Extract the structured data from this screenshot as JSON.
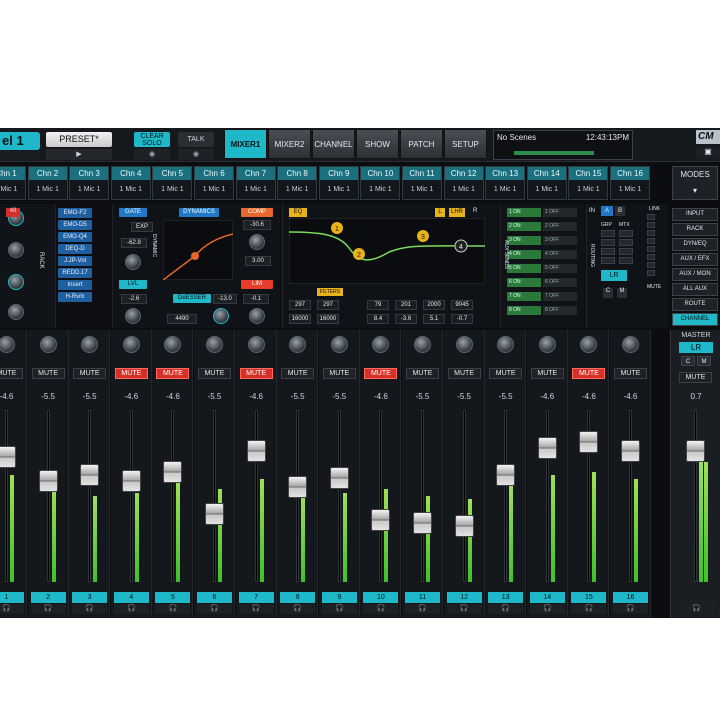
{
  "topbar": {
    "channel_name": "el 1",
    "preset_label": "PRESET*",
    "clear_solo_line1": "CLEAR",
    "clear_solo_line2": "SOLO",
    "talk_label": "TALK",
    "tabs": [
      "MIXER1",
      "MIXER2",
      "CHANNEL",
      "SHOW",
      "PATCH",
      "SETUP"
    ],
    "active_tab": "MIXER1",
    "scene_name": "No Scenes",
    "clock": "12:43:13PM",
    "logo": "CM"
  },
  "channel_row": [
    {
      "name": "Chn 1",
      "source": "1 Mic 1"
    },
    {
      "name": "Chn 2",
      "source": "1 Mic 1"
    },
    {
      "name": "Chn 3",
      "source": "1 Mic 1"
    },
    {
      "name": "Chn 4",
      "source": "1 Mic 1"
    },
    {
      "name": "Chn 5",
      "source": "1 Mic 1"
    },
    {
      "name": "Chn 6",
      "source": "1 Mic 1"
    },
    {
      "name": "Chn 7",
      "source": "1 Mic 1"
    },
    {
      "name": "Chn 8",
      "source": "1 Mic 1"
    },
    {
      "name": "Chn 9",
      "source": "1 Mic 1"
    },
    {
      "name": "Chn 10",
      "source": "1 Mic 1"
    },
    {
      "name": "Chn 11",
      "source": "1 Mic 1"
    },
    {
      "name": "Chn 12",
      "source": "1 Mic 1"
    },
    {
      "name": "Chn 13",
      "source": "1 Mic 1"
    },
    {
      "name": "Chn 14",
      "source": "1 Mic 1"
    },
    {
      "name": "Chn 15",
      "source": "1 Mic 1"
    },
    {
      "name": "Chn 16",
      "source": "1 Mic 1"
    }
  ],
  "modes_label": "MODES",
  "rack": {
    "label": "RACK",
    "plugins": [
      "EMO-F2",
      "EMO-D5",
      "EMO-Q4",
      "DEQ-D",
      "J.JP-Vol",
      "REDD.17",
      "Insert",
      "H-Rvrb"
    ]
  },
  "dynamics": {
    "gate_label": "GATE",
    "dynamics_label": "DYNAMICS",
    "comp_label": "COMP",
    "lvl_label": "LVL",
    "deesser_label": "DeESSER",
    "lim_label": "LIM",
    "exp_label": "EXP",
    "side_label": "DYNAMIC",
    "gate_value": "-62.8",
    "comp_value": "-30.6",
    "ratio_value": "3.00",
    "lvl_value": "-2.6",
    "deesser_value": "-13.0",
    "lim_value": "-0.1",
    "freq_value": "4490"
  },
  "eq": {
    "label": "EQ",
    "filters_label": "FILTERS",
    "bands": [
      "1",
      "2",
      "3",
      "4"
    ],
    "freq_values": [
      "297",
      "297",
      "79",
      "201",
      "2000",
      "9045"
    ],
    "row2_values": [
      "16000",
      "16000",
      "8.4",
      "-3.6",
      "5.1",
      "-0.7"
    ],
    "flags": [
      "L",
      "LHR",
      "R"
    ]
  },
  "aux_sends": {
    "label": "AUX SENDS",
    "on_labels": [
      "1 ON",
      "2 ON",
      "3 ON",
      "4 ON",
      "5 ON",
      "6 ON",
      "7 ON",
      "8 ON"
    ],
    "off_labels": [
      "1 OFF",
      "2 OFF",
      "3 OFF",
      "4 OFF",
      "5 OFF",
      "6 OFF",
      "7 OFF",
      "8 OFF"
    ]
  },
  "routing": {
    "label": "ROUTING",
    "in_label": "IN",
    "grp_label": "GRP",
    "mtx_label": "MTX",
    "lr_label": "LR",
    "link_label": "LINK",
    "mute_label": "MUTE",
    "c_label": "C",
    "m_label": "M"
  },
  "mode_buttons": [
    "INPUT",
    "RACK",
    "DYN/EQ",
    "AUX / EFX",
    "AUX / MON",
    "ALL AUX",
    "ROUTE",
    "CHANNEL"
  ],
  "active_mode": "CHANNEL",
  "strips": [
    {
      "num": "1",
      "mute": "MUTE",
      "mute_on": false,
      "db": "-4.6",
      "fader": 0.76,
      "meter": 0.62
    },
    {
      "num": "2",
      "mute": "MUTE",
      "mute_on": false,
      "db": "-5.5",
      "fader": 0.6,
      "meter": 0.55
    },
    {
      "num": "3",
      "mute": "MUTE",
      "mute_on": false,
      "db": "-5.5",
      "fader": 0.64,
      "meter": 0.5
    },
    {
      "num": "4",
      "mute": "MUTE",
      "mute_on": true,
      "db": "-4.6",
      "fader": 0.6,
      "meter": 0.52
    },
    {
      "num": "5",
      "mute": "MUTE",
      "mute_on": true,
      "db": "-4.6",
      "fader": 0.66,
      "meter": 0.58
    },
    {
      "num": "6",
      "mute": "MUTE",
      "mute_on": false,
      "db": "-5.5",
      "fader": 0.38,
      "meter": 0.54
    },
    {
      "num": "7",
      "mute": "MUTE",
      "mute_on": true,
      "db": "-4.6",
      "fader": 0.8,
      "meter": 0.6
    },
    {
      "num": "8",
      "mute": "MUTE",
      "mute_on": false,
      "db": "-5.5",
      "fader": 0.56,
      "meter": 0.5
    },
    {
      "num": "9",
      "mute": "MUTE",
      "mute_on": false,
      "db": "-5.5",
      "fader": 0.62,
      "meter": 0.52
    },
    {
      "num": "10",
      "mute": "MUTE",
      "mute_on": true,
      "db": "-4.6",
      "fader": 0.34,
      "meter": 0.54
    },
    {
      "num": "11",
      "mute": "MUTE",
      "mute_on": false,
      "db": "-5.5",
      "fader": 0.32,
      "meter": 0.5
    },
    {
      "num": "12",
      "mute": "MUTE",
      "mute_on": false,
      "db": "-5.5",
      "fader": 0.3,
      "meter": 0.48
    },
    {
      "num": "13",
      "mute": "MUTE",
      "mute_on": false,
      "db": "-5.5",
      "fader": 0.64,
      "meter": 0.56
    },
    {
      "num": "14",
      "mute": "MUTE",
      "mute_on": false,
      "db": "-4.6",
      "fader": 0.82,
      "meter": 0.62
    },
    {
      "num": "15",
      "mute": "MUTE",
      "mute_on": true,
      "db": "-4.6",
      "fader": 0.86,
      "meter": 0.64
    },
    {
      "num": "16",
      "mute": "MUTE",
      "mute_on": false,
      "db": "-4.6",
      "fader": 0.8,
      "meter": 0.6
    }
  ],
  "master": {
    "label": "MASTER",
    "bus": "LR",
    "c": "C",
    "m": "M",
    "mute": "MUTE",
    "db": "0.7",
    "fader": 0.8,
    "meter": 0.7
  },
  "colors": {
    "accent": "#1fb8c9",
    "mute_on": "#d5302a",
    "meter": "#3fc02a",
    "eq": "#e8b21b",
    "comp": "#e8682b"
  }
}
